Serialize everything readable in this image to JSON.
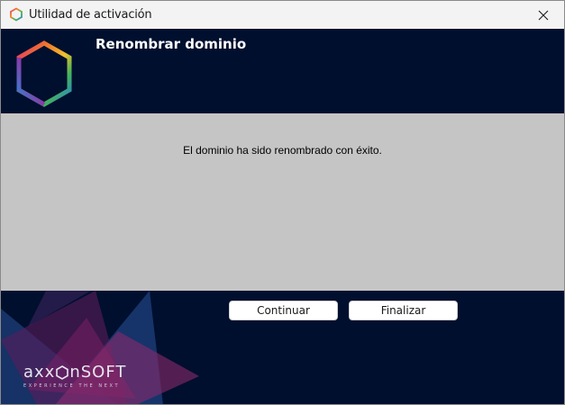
{
  "window": {
    "title": "Utilidad de activación",
    "app_icon": "hexagon-icon",
    "close_icon": "close-icon"
  },
  "header": {
    "title": "Renombrar dominio",
    "logo": "hexagon-logo"
  },
  "main": {
    "message": "El dominio ha sido renombrado con éxito."
  },
  "footer": {
    "brand_name_prefix": "axx",
    "brand_name_suffix": "nSOFT",
    "brand_tagline": "EXPERIENCE THE NEXT",
    "buttons": {
      "continue_label": "Continuar",
      "finish_label": "Finalizar"
    }
  },
  "colors": {
    "header_bg": "#000f2e",
    "content_bg": "#c5c5c5",
    "titlebar_bg": "#f3f3f3"
  }
}
